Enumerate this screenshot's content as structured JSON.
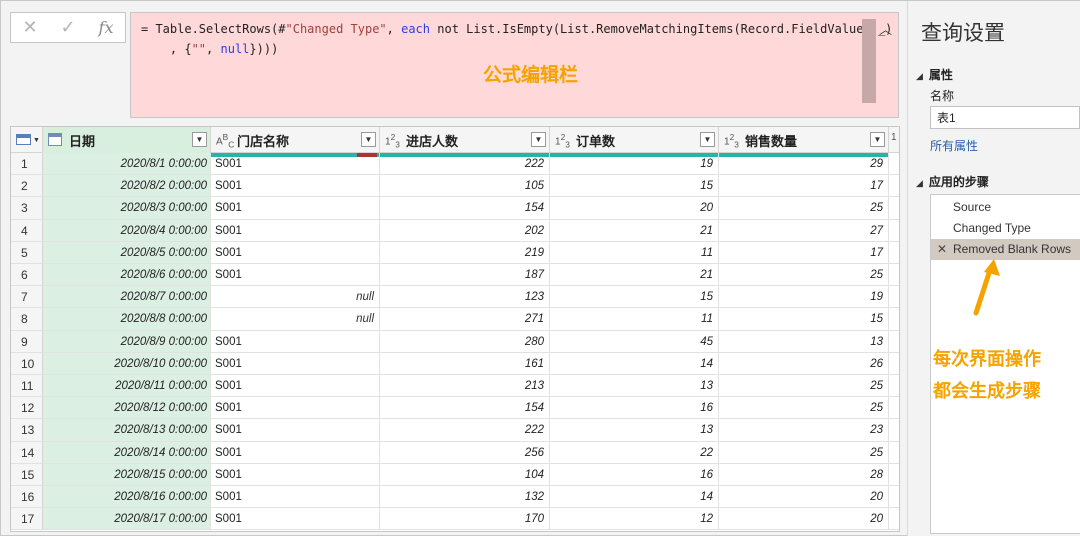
{
  "formula_bar": {
    "cancel_icon": "x-icon",
    "confirm_icon": "check-icon",
    "fx_label": "fx",
    "line1": {
      "p1": "= Table.SelectRows(#",
      "s1": "\"Changed Type\"",
      "p2": ", ",
      "kw": "each",
      "p3": " not List.IsEmpty(List.RemoveMatchingItems(Record.FieldValues(_)"
    },
    "line2": {
      "p1": "    , {",
      "s1": "\"\"",
      "p2": ", ",
      "kw": "null",
      "p3": "})))"
    },
    "annotation": "公式编辑栏",
    "expand_icon": "chevron-up-icon"
  },
  "grid": {
    "columns": [
      {
        "name": "日期",
        "type_icon": "datetime-type-icon"
      },
      {
        "name": "门店名称",
        "type_icon": "text-type-icon",
        "type_label": "ABC"
      },
      {
        "name": "进店人数",
        "type_icon": "number-type-icon",
        "type_label": "123"
      },
      {
        "name": "订单数",
        "type_icon": "number-type-icon",
        "type_label": "123"
      },
      {
        "name": "销售数量",
        "type_icon": "number-type-icon",
        "type_label": "123"
      }
    ],
    "rows": [
      {
        "idx": "1",
        "date": "2020/8/1 0:00:00",
        "store": "S001",
        "visitors": "222",
        "orders": "19",
        "qty": "29"
      },
      {
        "idx": "2",
        "date": "2020/8/2 0:00:00",
        "store": "S001",
        "visitors": "105",
        "orders": "15",
        "qty": "17"
      },
      {
        "idx": "3",
        "date": "2020/8/3 0:00:00",
        "store": "S001",
        "visitors": "154",
        "orders": "20",
        "qty": "25"
      },
      {
        "idx": "4",
        "date": "2020/8/4 0:00:00",
        "store": "S001",
        "visitors": "202",
        "orders": "21",
        "qty": "27"
      },
      {
        "idx": "5",
        "date": "2020/8/5 0:00:00",
        "store": "S001",
        "visitors": "219",
        "orders": "11",
        "qty": "17"
      },
      {
        "idx": "6",
        "date": "2020/8/6 0:00:00",
        "store": "S001",
        "visitors": "187",
        "orders": "21",
        "qty": "25"
      },
      {
        "idx": "7",
        "date": "2020/8/7 0:00:00",
        "store": "null",
        "visitors": "123",
        "orders": "15",
        "qty": "19"
      },
      {
        "idx": "8",
        "date": "2020/8/8 0:00:00",
        "store": "null",
        "visitors": "271",
        "orders": "11",
        "qty": "15"
      },
      {
        "idx": "9",
        "date": "2020/8/9 0:00:00",
        "store": "S001",
        "visitors": "280",
        "orders": "45",
        "qty": "13"
      },
      {
        "idx": "10",
        "date": "2020/8/10 0:00:00",
        "store": "S001",
        "visitors": "161",
        "orders": "14",
        "qty": "26"
      },
      {
        "idx": "11",
        "date": "2020/8/11 0:00:00",
        "store": "S001",
        "visitors": "213",
        "orders": "13",
        "qty": "25"
      },
      {
        "idx": "12",
        "date": "2020/8/12 0:00:00",
        "store": "S001",
        "visitors": "154",
        "orders": "16",
        "qty": "25"
      },
      {
        "idx": "13",
        "date": "2020/8/13 0:00:00",
        "store": "S001",
        "visitors": "222",
        "orders": "13",
        "qty": "23"
      },
      {
        "idx": "14",
        "date": "2020/8/14 0:00:00",
        "store": "S001",
        "visitors": "256",
        "orders": "22",
        "qty": "25"
      },
      {
        "idx": "15",
        "date": "2020/8/15 0:00:00",
        "store": "S001",
        "visitors": "104",
        "orders": "16",
        "qty": "28"
      },
      {
        "idx": "16",
        "date": "2020/8/16 0:00:00",
        "store": "S001",
        "visitors": "132",
        "orders": "14",
        "qty": "20"
      },
      {
        "idx": "17",
        "date": "2020/8/17 0:00:00",
        "store": "S001",
        "visitors": "170",
        "orders": "12",
        "qty": "20"
      }
    ]
  },
  "query_settings": {
    "title": "查询设置",
    "properties_header": "属性",
    "name_label": "名称",
    "name_value": "表1",
    "all_properties_link": "所有属性",
    "applied_steps_header": "应用的步骤",
    "steps": [
      "Source",
      "Changed Type",
      "Removed Blank Rows"
    ],
    "annotation_line1": "每次界面操作",
    "annotation_line2": "都会生成步骤"
  },
  "colors": {
    "annotation": "#f5a300",
    "formula_bg": "#ffd8d9",
    "date_column_bg": "#dcefe3",
    "quality_bar": "#27b3a8",
    "selected_step_bg": "#d2c9c1"
  }
}
